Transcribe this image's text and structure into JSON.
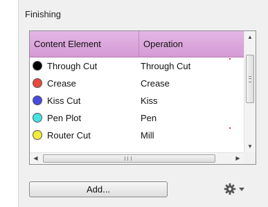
{
  "section": {
    "title": "Finishing"
  },
  "table": {
    "columns": [
      "Content Element",
      "Operation"
    ],
    "rows": [
      {
        "element": "Through Cut",
        "operation": "Through Cut",
        "color": "#000000",
        "marked": true
      },
      {
        "element": "Crease",
        "operation": "Crease",
        "color": "#e84a3a",
        "marked": false
      },
      {
        "element": "Kiss Cut",
        "operation": "Kiss",
        "color": "#4a4ae0",
        "marked": false
      },
      {
        "element": "Pen Plot",
        "operation": "Pen",
        "color": "#45e4e4",
        "marked": false
      },
      {
        "element": "Router Cut",
        "operation": "Mill",
        "color": "#f2ec38",
        "marked": true
      }
    ],
    "scroll": {
      "up": "▲",
      "down": "▼",
      "left": "◀",
      "right": "▶"
    }
  },
  "buttons": {
    "add_label": "Add..."
  },
  "icons": {
    "gear": "gear-icon",
    "caret": "chevron-down-icon"
  }
}
